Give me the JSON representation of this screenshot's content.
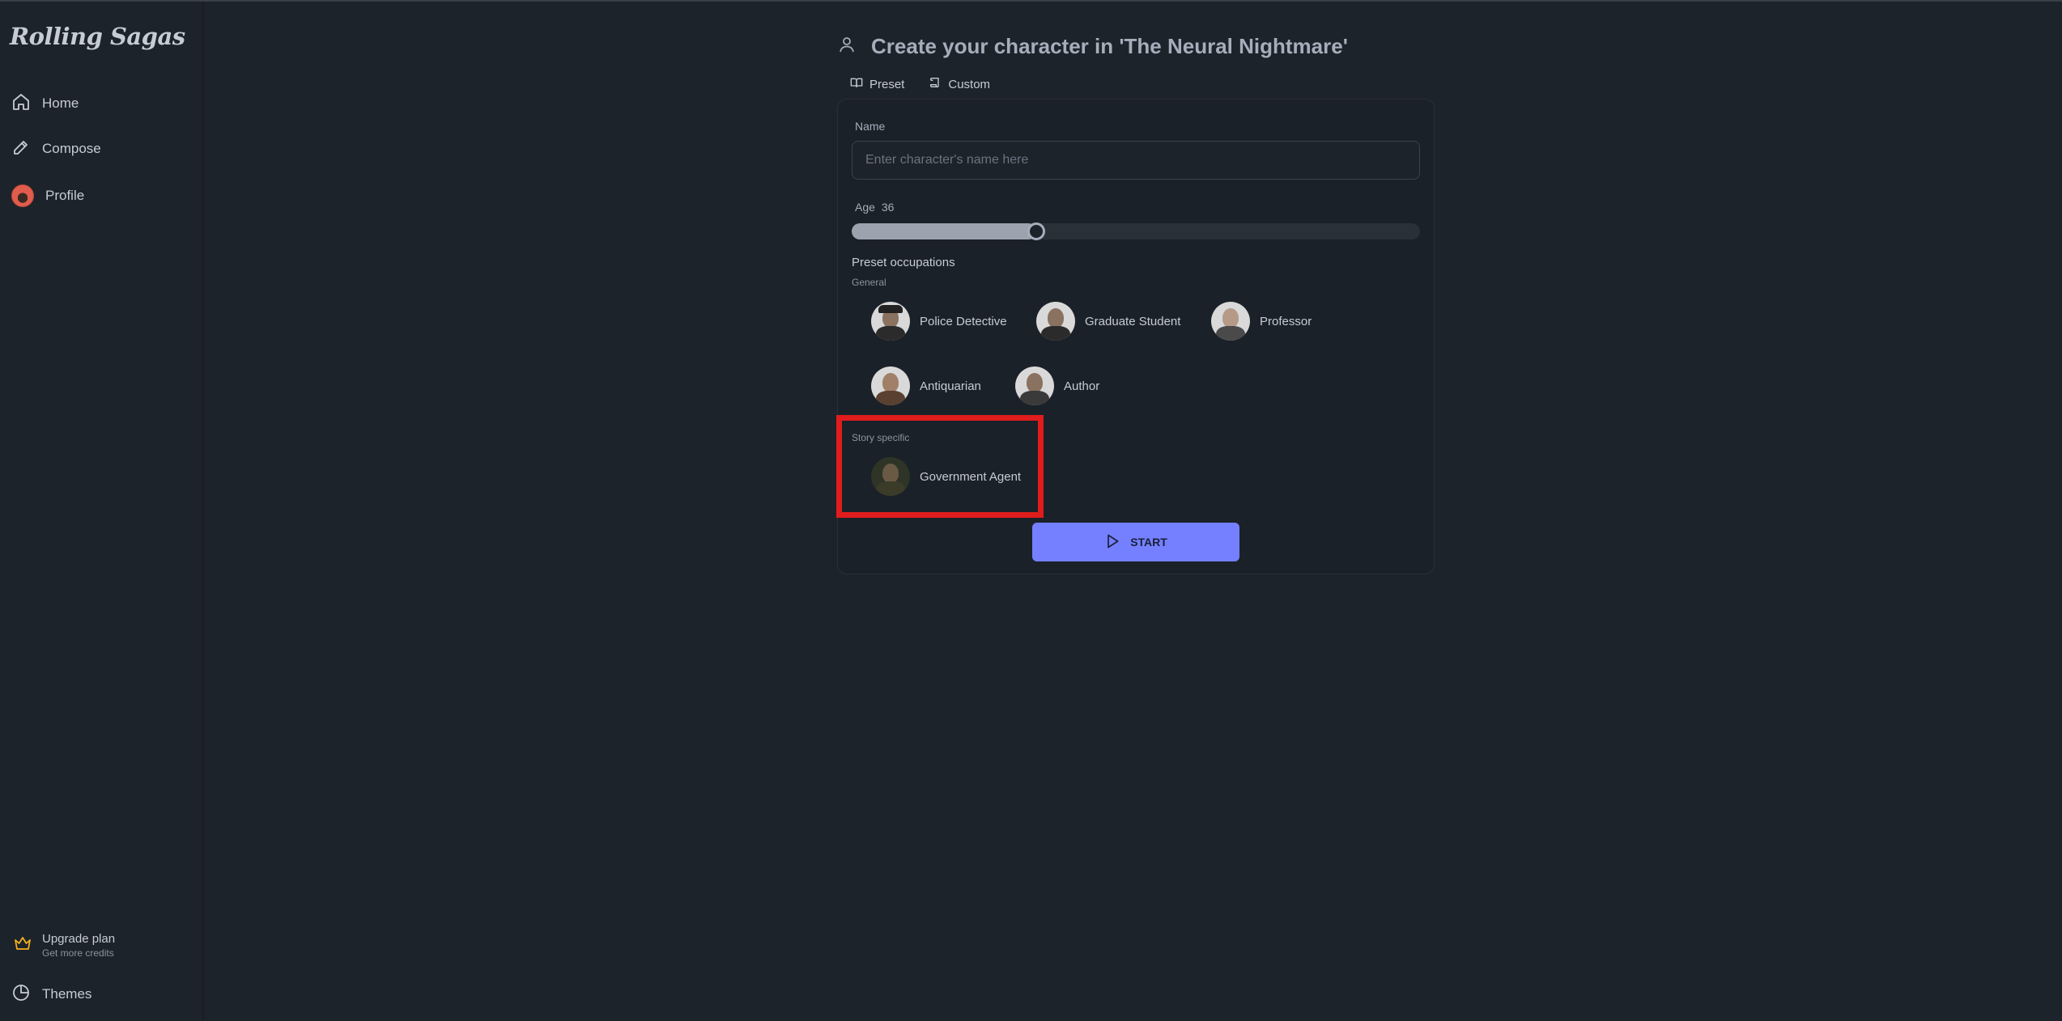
{
  "app": {
    "logo": "Rolling Sagas"
  },
  "sidebar": {
    "items": [
      {
        "label": "Home",
        "icon": "home-icon"
      },
      {
        "label": "Compose",
        "icon": "pencil-icon"
      },
      {
        "label": "Profile",
        "icon": "avatar"
      }
    ],
    "upgrade": {
      "title": "Upgrade plan",
      "subtitle": "Get more credits",
      "icon": "crown-icon"
    },
    "themes": {
      "label": "Themes",
      "icon": "palette-icon"
    }
  },
  "main": {
    "title": "Create your character in 'The Neural Nightmare'",
    "tabs": [
      {
        "label": "Preset",
        "icon": "book-icon",
        "active": true
      },
      {
        "label": "Custom",
        "icon": "scroll-icon",
        "active": false
      }
    ],
    "name": {
      "label": "Name",
      "placeholder": "Enter character's name here",
      "value": ""
    },
    "age": {
      "label": "Age",
      "value": "36",
      "fraction": 0.325
    },
    "occupations": {
      "title": "Preset occupations",
      "general_label": "General",
      "general": [
        {
          "label": "Police Detective",
          "icon": "police-detective-portrait"
        },
        {
          "label": "Graduate Student",
          "icon": "graduate-student-portrait"
        },
        {
          "label": "Professor",
          "icon": "professor-portrait"
        },
        {
          "label": "Antiquarian",
          "icon": "antiquarian-portrait"
        },
        {
          "label": "Author",
          "icon": "author-portrait"
        }
      ],
      "story_label": "Story specific",
      "story": [
        {
          "label": "Government Agent",
          "icon": "government-agent-portrait"
        }
      ]
    },
    "start_label": "START"
  },
  "colors": {
    "background": "#1d232a",
    "primary": "#7480ff",
    "highlight": "#e01c1c"
  }
}
